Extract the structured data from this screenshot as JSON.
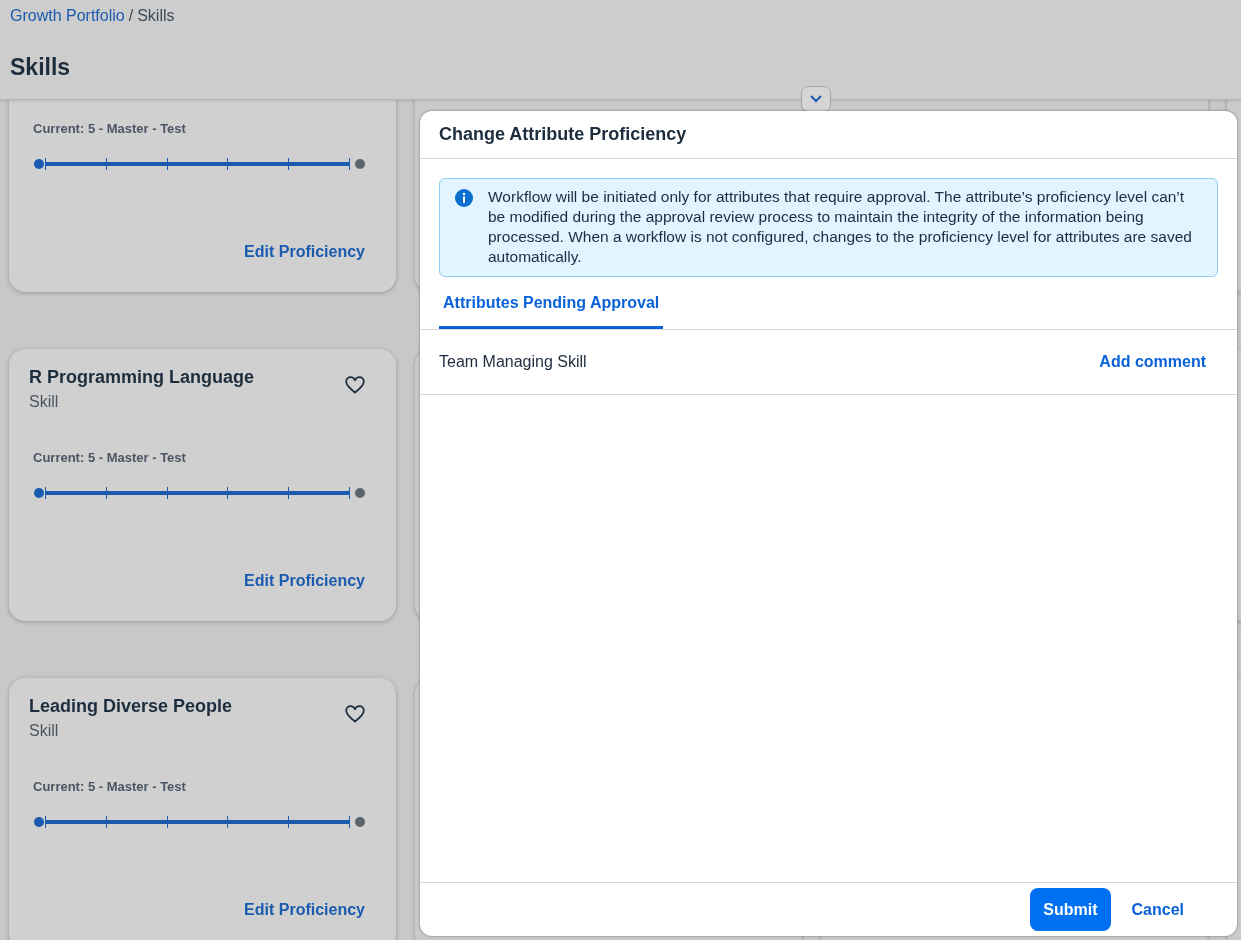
{
  "breadcrumb": {
    "items": [
      {
        "label": "Growth Portfolio",
        "kind": "link"
      },
      {
        "label": "Skills",
        "kind": "current"
      }
    ],
    "separator": "/"
  },
  "page_title": "Skills",
  "skill_cards": [
    {
      "current": "Current: 5 - Master - Test",
      "level": 1,
      "action": "Edit Proficiency"
    },
    {
      "title": "R Programming Language",
      "subtitle": "Skill",
      "favorite": false,
      "current": "Current: 5 - Master - Test",
      "level": 1,
      "action": "Edit Proficiency"
    },
    {
      "title": "Leading Diverse People",
      "subtitle": "Skill",
      "favorite": false,
      "current": "Current: 5 - Master - Test",
      "level": 1,
      "action": "Edit Proficiency"
    }
  ],
  "dialog": {
    "title": "Change Attribute Proficiency",
    "info_message": "Workflow will be initiated only for attributes that require approval. The attribute’s proficiency level can’t be modified during the approval review process to maintain the integrity of the information being processed. When a workflow is not configured, changes to the proficiency level for attributes are saved automatically.",
    "tabs": [
      {
        "label": "Attributes Pending Approval",
        "selected": true
      }
    ],
    "rows": [
      {
        "name": "Team Managing Skill",
        "action": "Add comment"
      }
    ],
    "buttons": [
      {
        "label": "Submit",
        "kind": "primary"
      },
      {
        "label": "Cancel",
        "kind": "transparent"
      }
    ]
  }
}
